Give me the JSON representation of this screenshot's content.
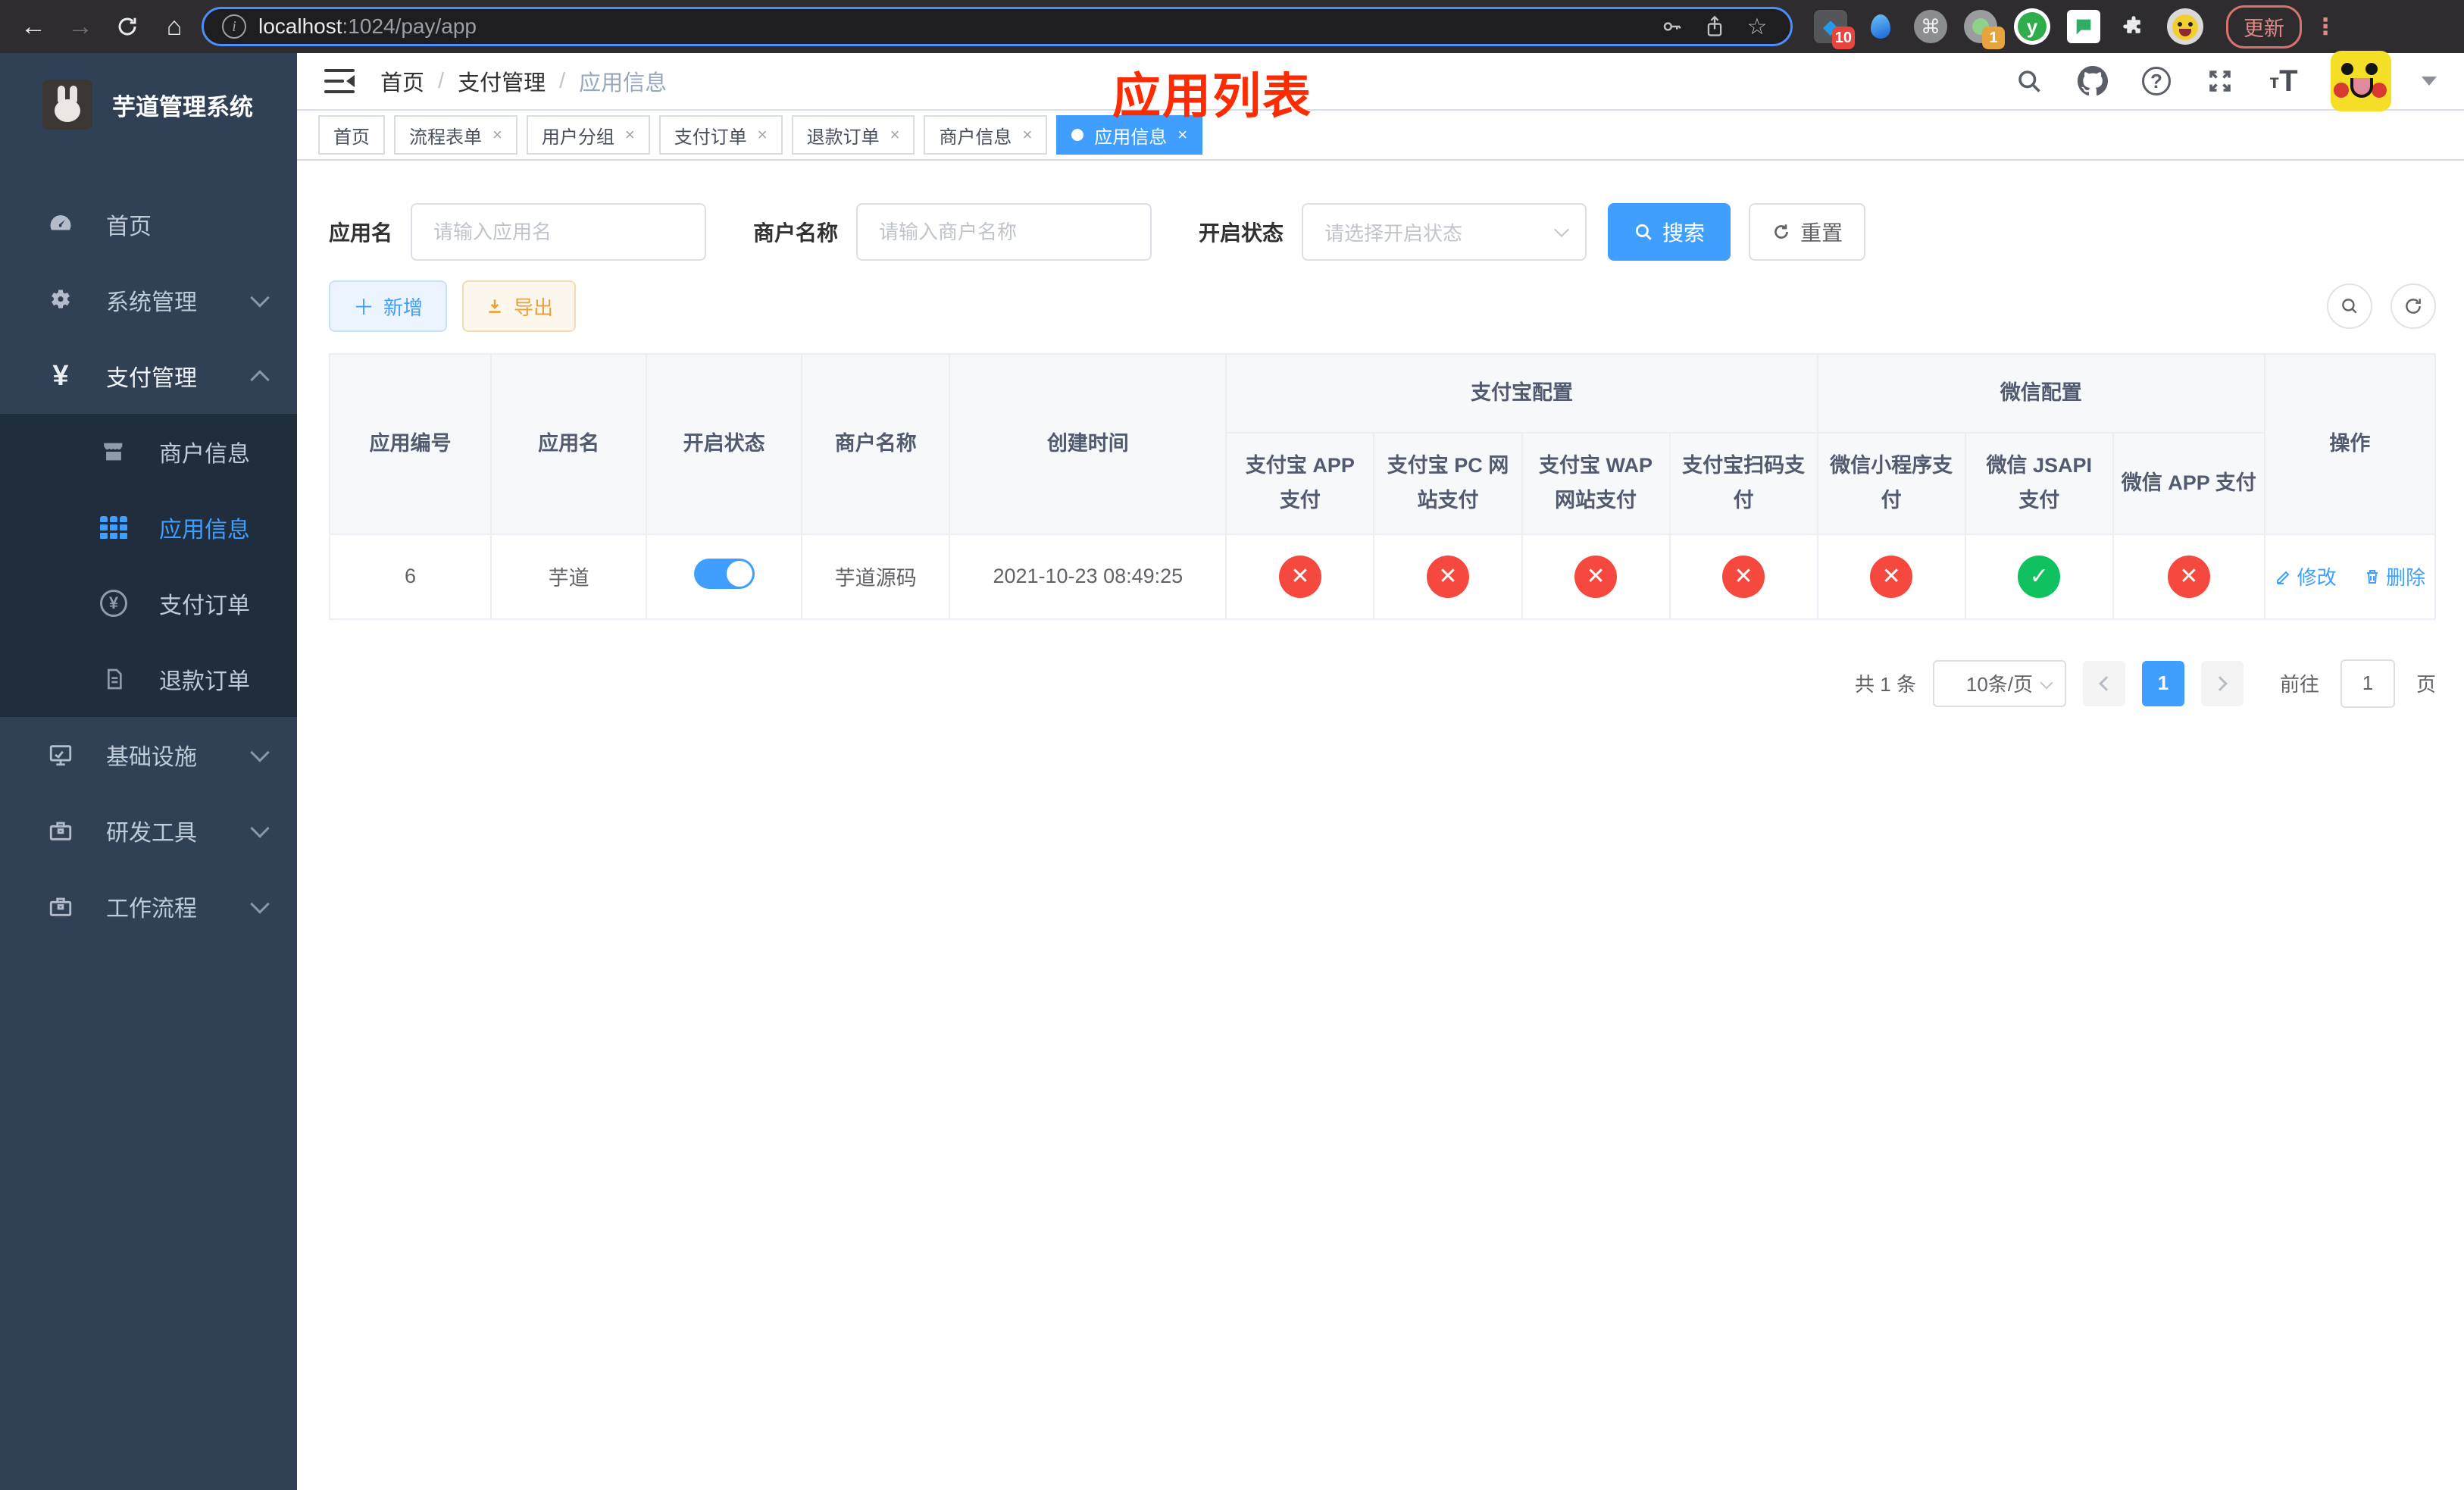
{
  "browser": {
    "url_host": "localhost",
    "url_rest": ":1024/pay/app",
    "update_label": "更新",
    "ext_badge_blue": "10",
    "ext_badge_record": "1",
    "ext_y_label": "y"
  },
  "annotation": "应用列表",
  "app": {
    "title": "芋道管理系统"
  },
  "breadcrumb": {
    "separator": "/",
    "items": [
      "首页",
      "支付管理",
      "应用信息"
    ]
  },
  "header_icons": {
    "question_glyph": "?",
    "text_size_small": "т",
    "text_size_big": "T"
  },
  "tabs": [
    {
      "label": "首页",
      "closable": false
    },
    {
      "label": "流程表单",
      "closable": true
    },
    {
      "label": "用户分组",
      "closable": true
    },
    {
      "label": "支付订单",
      "closable": true
    },
    {
      "label": "退款订单",
      "closable": true
    },
    {
      "label": "商户信息",
      "closable": true
    },
    {
      "label": "应用信息",
      "closable": true,
      "active": true
    }
  ],
  "tab_close_glyph": "×",
  "sidebar": {
    "items": [
      {
        "label": "首页"
      },
      {
        "label": "系统管理",
        "chevron": "down"
      },
      {
        "label": "支付管理",
        "chevron": "up",
        "children": [
          {
            "label": "商户信息"
          },
          {
            "label": "应用信息",
            "active": true
          },
          {
            "label": "支付订单"
          },
          {
            "label": "退款订单"
          }
        ]
      },
      {
        "label": "基础设施",
        "chevron": "down"
      },
      {
        "label": "研发工具",
        "chevron": "down"
      },
      {
        "label": "工作流程",
        "chevron": "down"
      }
    ]
  },
  "filters": {
    "app_name_label": "应用名",
    "app_name_placeholder": "请输入应用名",
    "merchant_label": "商户名称",
    "merchant_placeholder": "请输入商户名称",
    "status_label": "开启状态",
    "status_placeholder": "请选择开启状态",
    "search_label": "搜索",
    "reset_label": "重置"
  },
  "toolbar": {
    "add_label": "新增",
    "export_label": "导出"
  },
  "table": {
    "top_headers": [
      "应用编号",
      "应用名",
      "开启状态",
      "商户名称",
      "创建时间"
    ],
    "groups": [
      {
        "label": "支付宝配置"
      },
      {
        "label": "微信配置"
      }
    ],
    "sub_headers": [
      "支付宝 APP 支付",
      "支付宝 PC 网站支付",
      "支付宝 WAP 网站支付",
      "支付宝扫码支付",
      "微信小程序支付",
      "微信 JSAPI 支付",
      "微信 APP 支付"
    ],
    "op_header": "操作",
    "rows": [
      {
        "id": "6",
        "name": "芋道",
        "enabled": true,
        "merchant": "芋道源码",
        "created": "2021-10-23 08:49:25",
        "statuses": [
          false,
          false,
          false,
          false,
          false,
          true,
          false
        ],
        "edit_label": "修改",
        "delete_label": "删除"
      }
    ],
    "status_glyphs": {
      "yes": "✓",
      "no": "✕"
    }
  },
  "pagination": {
    "total": "共 1 条",
    "page_size": "10条/页",
    "current_page": "1",
    "goto_prefix": "前往",
    "goto_value": "1",
    "goto_suffix": "页"
  }
}
